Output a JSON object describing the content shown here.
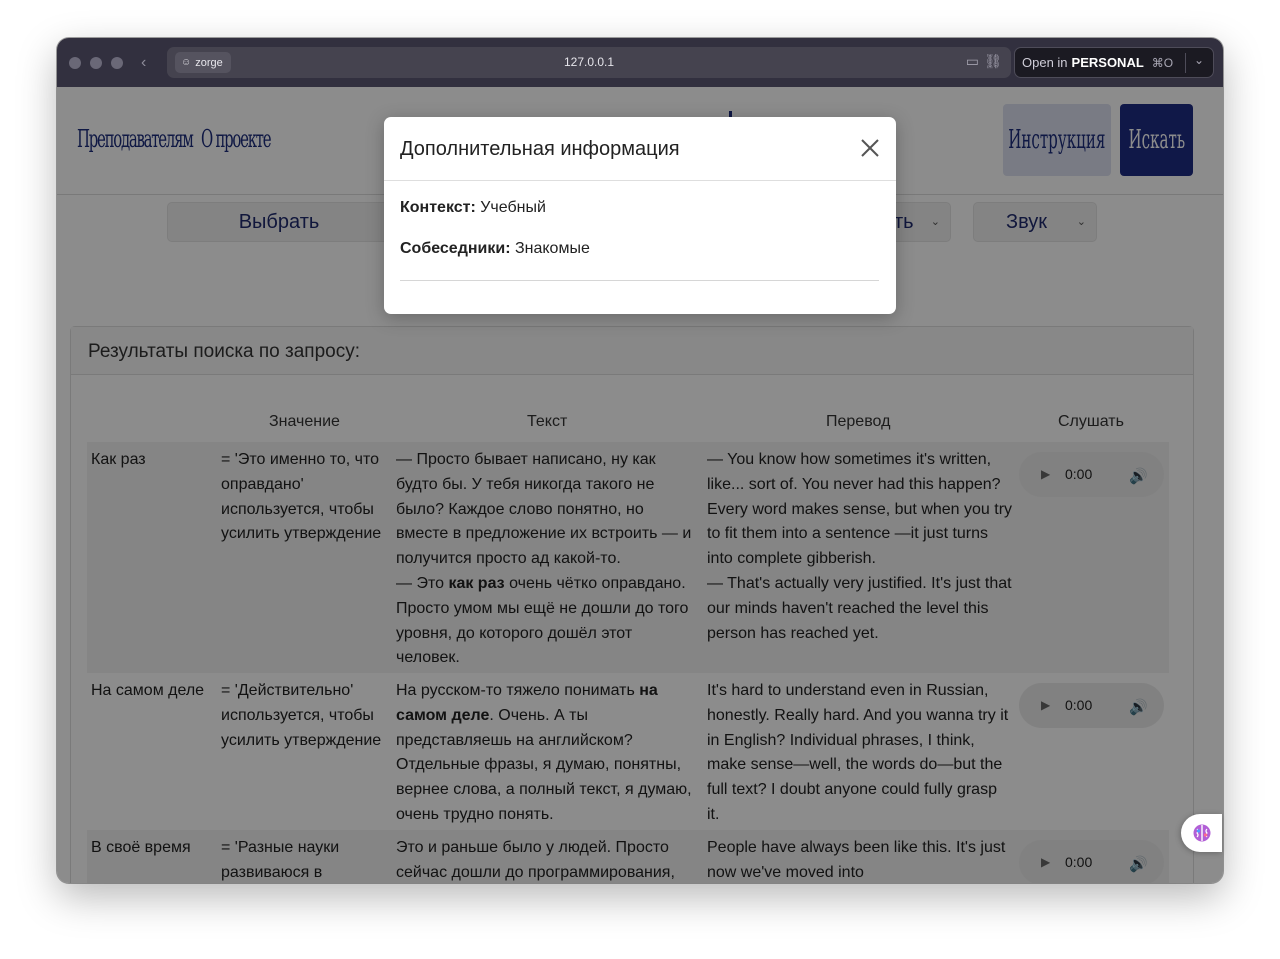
{
  "browser": {
    "site_chip": "zorge",
    "url": "127.0.0.1",
    "open_in_prefix": "Open in",
    "open_in_profile": "PERSONAL",
    "open_in_shortcut": "⌘O"
  },
  "nav": {
    "link_teachers": "Преподавателям",
    "link_about": "О проекте",
    "instructions_button": "Инструкция",
    "search_button": "Искать"
  },
  "filters": {
    "choose_button": "Выбрать",
    "partial_select": "ть",
    "sound_select": "Звук"
  },
  "results": {
    "heading": "Результаты поиска по запросу:",
    "columns": [
      "",
      "Значение",
      "Текст",
      "Перевод",
      "Слушать"
    ],
    "rows": [
      {
        "phrase": "Как раз",
        "meaning": "= 'Это именно то, что оправдано' используется, чтобы усилить утверждение",
        "text_a": "— Просто бывает написано, ну как будто бы. У тебя никогда такого не было? Каждое слово понятно, но вместе в предложение их встроить — и получится просто ад какой-то.",
        "text_b_pre": "— Это ",
        "text_b_bold": "как раз",
        "text_b_post": " очень чётко оправдано. Просто умом мы ещё не дошли до того уровня, до которого дошёл этот человек.",
        "translation_a": "— You know how sometimes it's written, like... sort of. You never had this happen? Every word makes sense, but when you try to fit them into a sentence —it just turns into complete gibberish.",
        "translation_b": "— That's actually very justified. It's just that our minds haven't reached the level this person has reached yet.",
        "audio_time": "0:00"
      },
      {
        "phrase": "На самом деле",
        "meaning": "= 'Действительно' используется, чтобы усилить утверждение",
        "text_pre": "На русском-то тяжело понимать ",
        "text_bold": "на самом деле",
        "text_post": ". Очень. А ты представляешь на английском? Отдельные фразы, я думаю, понятны, вернее слова, а полный текст, я думаю, очень трудно понять.",
        "translation": "It's hard to understand even in Russian, honestly. Really hard. And you wanna try it in English? Individual phrases, I think, make sense—well, the words do—but the full text? I doubt anyone could fully grasp it.",
        "audio_time": "0:00"
      },
      {
        "phrase": "В своё время",
        "meaning": "= 'Разные науки развиваюся в",
        "text": "Это и раньше было у людей. Просто сейчас дошли до программирования,",
        "translation": "People have always been like this. It's just now we've moved into",
        "audio_time": "0:00"
      }
    ]
  },
  "modal": {
    "title": "Дополнительная информация",
    "context_label": "Контекст:",
    "context_value": " Учебный",
    "speakers_label": "Собеседники:",
    "speakers_value": " Знакомые"
  }
}
